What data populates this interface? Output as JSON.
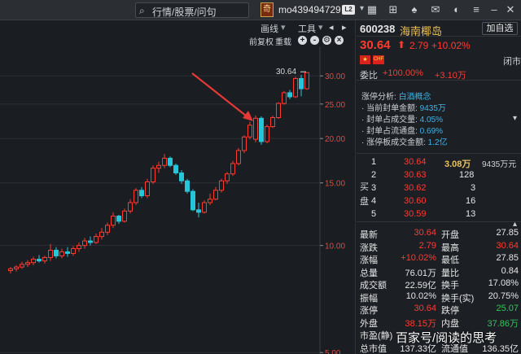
{
  "topbar": {
    "search_placeholder": "行情/股票/问句",
    "avatar_glyph": "奇",
    "username": "mo439494729",
    "level_badge": "L2",
    "icons": [
      "grid-icon",
      "gift-icon",
      "shirt-icon",
      "mail-icon",
      "palette-icon",
      "menu-icon",
      "minimize-icon",
      "maximize-icon",
      "close-icon"
    ]
  },
  "chart_toolbar": {
    "draw_line": "画线",
    "tools": "工具",
    "pre_adjust": "前复权",
    "overlay": "重载",
    "zoom_in": "+",
    "zoom_out": "-",
    "settings": "⚙",
    "close": "×"
  },
  "chart_data": {
    "type": "candlestick",
    "ylabel_ticks": [
      "30.00",
      "25.00",
      "20.00",
      "15.00",
      "10.00",
      "5.00"
    ],
    "y_scale": "log",
    "ylim": [
      5.0,
      32.0
    ],
    "high_label": "30.64",
    "annotation": "arrow pointing to large bullish candle",
    "candles": [
      {
        "o": 8.5,
        "h": 8.7,
        "l": 8.35,
        "c": 8.6
      },
      {
        "o": 8.6,
        "h": 8.8,
        "l": 8.45,
        "c": 8.7
      },
      {
        "o": 8.7,
        "h": 9.0,
        "l": 8.6,
        "c": 8.85
      },
      {
        "o": 8.85,
        "h": 9.1,
        "l": 8.7,
        "c": 8.95
      },
      {
        "o": 8.95,
        "h": 9.3,
        "l": 8.8,
        "c": 9.15
      },
      {
        "o": 9.15,
        "h": 9.4,
        "l": 8.95,
        "c": 9.05
      },
      {
        "o": 9.05,
        "h": 9.35,
        "l": 8.9,
        "c": 9.25
      },
      {
        "o": 9.25,
        "h": 10.1,
        "l": 9.05,
        "c": 9.7
      },
      {
        "o": 9.7,
        "h": 9.9,
        "l": 9.2,
        "c": 9.35
      },
      {
        "o": 9.35,
        "h": 9.8,
        "l": 9.2,
        "c": 9.6
      },
      {
        "o": 9.6,
        "h": 9.9,
        "l": 9.3,
        "c": 9.5
      },
      {
        "o": 9.5,
        "h": 9.95,
        "l": 9.35,
        "c": 9.8
      },
      {
        "o": 9.8,
        "h": 10.2,
        "l": 9.6,
        "c": 10.0
      },
      {
        "o": 10.0,
        "h": 10.5,
        "l": 9.8,
        "c": 10.3
      },
      {
        "o": 10.3,
        "h": 10.6,
        "l": 10.0,
        "c": 10.2
      },
      {
        "o": 10.2,
        "h": 10.8,
        "l": 10.1,
        "c": 10.6
      },
      {
        "o": 10.6,
        "h": 11.2,
        "l": 10.4,
        "c": 10.9
      },
      {
        "o": 10.9,
        "h": 11.6,
        "l": 10.7,
        "c": 11.4
      },
      {
        "o": 11.4,
        "h": 12.4,
        "l": 11.2,
        "c": 12.1
      },
      {
        "o": 12.1,
        "h": 12.2,
        "l": 11.5,
        "c": 11.7
      },
      {
        "o": 11.7,
        "h": 12.7,
        "l": 11.6,
        "c": 12.5
      },
      {
        "o": 12.5,
        "h": 13.5,
        "l": 12.3,
        "c": 13.2
      },
      {
        "o": 13.2,
        "h": 14.5,
        "l": 13.0,
        "c": 14.3
      },
      {
        "o": 14.3,
        "h": 14.6,
        "l": 13.6,
        "c": 13.8
      },
      {
        "o": 13.8,
        "h": 15.4,
        "l": 13.6,
        "c": 15.1
      },
      {
        "o": 15.1,
        "h": 16.8,
        "l": 14.9,
        "c": 16.5
      },
      {
        "o": 16.5,
        "h": 17.2,
        "l": 16.0,
        "c": 16.8
      },
      {
        "o": 16.8,
        "h": 18.1,
        "l": 16.5,
        "c": 17.6
      },
      {
        "o": 17.6,
        "h": 17.8,
        "l": 16.6,
        "c": 16.8
      },
      {
        "o": 16.8,
        "h": 17.0,
        "l": 15.8,
        "c": 16.0
      },
      {
        "o": 16.0,
        "h": 16.3,
        "l": 14.9,
        "c": 15.2
      },
      {
        "o": 15.2,
        "h": 15.4,
        "l": 14.0,
        "c": 14.2
      },
      {
        "o": 14.2,
        "h": 14.4,
        "l": 12.5,
        "c": 12.6
      },
      {
        "o": 12.6,
        "h": 13.2,
        "l": 12.0,
        "c": 12.4
      },
      {
        "o": 12.4,
        "h": 13.4,
        "l": 12.3,
        "c": 13.2
      },
      {
        "o": 13.2,
        "h": 14.0,
        "l": 13.0,
        "c": 13.5
      },
      {
        "o": 13.5,
        "h": 14.6,
        "l": 13.4,
        "c": 14.3
      },
      {
        "o": 14.3,
        "h": 15.4,
        "l": 14.1,
        "c": 15.2
      },
      {
        "o": 15.2,
        "h": 16.1,
        "l": 14.9,
        "c": 15.9
      },
      {
        "o": 15.9,
        "h": 17.3,
        "l": 15.7,
        "c": 17.0
      },
      {
        "o": 17.0,
        "h": 18.8,
        "l": 16.8,
        "c": 18.5
      },
      {
        "o": 18.5,
        "h": 20.4,
        "l": 18.2,
        "c": 20.2
      },
      {
        "o": 20.2,
        "h": 22.3,
        "l": 19.9,
        "c": 21.8
      },
      {
        "o": 19.9,
        "h": 23.2,
        "l": 19.5,
        "c": 22.8
      },
      {
        "o": 22.8,
        "h": 23.1,
        "l": 19.2,
        "c": 19.6
      },
      {
        "o": 19.6,
        "h": 21.9,
        "l": 19.4,
        "c": 21.6
      },
      {
        "o": 21.6,
        "h": 23.2,
        "l": 21.4,
        "c": 22.9
      },
      {
        "o": 22.9,
        "h": 25.3,
        "l": 22.7,
        "c": 25.1
      },
      {
        "o": 25.1,
        "h": 27.2,
        "l": 24.9,
        "c": 26.9
      },
      {
        "o": 26.9,
        "h": 27.4,
        "l": 25.8,
        "c": 26.2
      },
      {
        "o": 26.2,
        "h": 29.8,
        "l": 26.0,
        "c": 29.5
      },
      {
        "o": 29.5,
        "h": 30.2,
        "l": 26.3,
        "c": 27.6
      },
      {
        "o": 27.6,
        "h": 30.64,
        "l": 27.4,
        "c": 30.64
      }
    ]
  },
  "quote": {
    "code": "600238",
    "name": "海南椰岛",
    "add_self": "加自选",
    "price": "30.64",
    "change": "2.79",
    "change_pct": "+10.02%",
    "flag1": "CN",
    "flag2": "CHF",
    "status": "闭市",
    "ratio_label": "委比",
    "ratio_pct": "+100.00%",
    "ratio_diff": "+3.10万"
  },
  "analysis": {
    "title_label": "涨停分析:",
    "title_value": "白酒概念",
    "lines": [
      {
        "label": "· 当前封单金额:",
        "value": "9435万"
      },
      {
        "label": "· 封单占成交量:",
        "value": "4.05%"
      },
      {
        "label": "· 封单占流通盘:",
        "value": "0.69%"
      },
      {
        "label": "· 涨停板成交金额:",
        "value": "1.2亿"
      }
    ]
  },
  "orderbook": {
    "side_label": "买盘",
    "side_chars": [
      "买",
      "盘"
    ],
    "total": "9435万元",
    "rows": [
      {
        "level": "1",
        "price": "30.64",
        "volume": "3.08万"
      },
      {
        "level": "2",
        "price": "30.63",
        "volume": "128"
      },
      {
        "level": "3",
        "price": "30.62",
        "volume": "3"
      },
      {
        "level": "4",
        "price": "30.60",
        "volume": "16"
      },
      {
        "level": "5",
        "price": "30.59",
        "volume": "13"
      }
    ]
  },
  "stats": [
    {
      "l1": "最新",
      "v1": "30.64",
      "c1": "red",
      "l2": "开盘",
      "v2": "27.85",
      "c2": "white"
    },
    {
      "l1": "涨跌",
      "v1": "2.79",
      "c1": "red",
      "l2": "最高",
      "v2": "30.64",
      "c2": "red"
    },
    {
      "l1": "涨幅",
      "v1": "+10.02%",
      "c1": "red",
      "l2": "最低",
      "v2": "27.85",
      "c2": "white"
    },
    {
      "l1": "总量",
      "v1": "76.01万",
      "c1": "white",
      "l2": "量比",
      "v2": "0.84",
      "c2": "white"
    },
    {
      "l1": "成交额",
      "v1": "22.59亿",
      "c1": "white",
      "l2": "换手",
      "v2": "17.08%",
      "c2": "white"
    },
    {
      "l1": "振幅",
      "v1": "10.02%",
      "c1": "white",
      "l2": "换手(实)",
      "v2": "20.75%",
      "c2": "white"
    },
    {
      "l1": "涨停",
      "v1": "30.64",
      "c1": "red",
      "l2": "跌停",
      "v2": "25.07",
      "c2": "green"
    },
    {
      "l1": "外盘",
      "v1": "38.15万",
      "c1": "red",
      "l2": "内盘",
      "v2": "37.86万",
      "c2": "green"
    },
    {
      "l1": "市盈(静)",
      "v1": "",
      "c1": "white",
      "l2": "",
      "v2": "",
      "c2": "white"
    },
    {
      "l1": "总市值",
      "v1": "137.33亿",
      "c1": "white",
      "l2": "流通值",
      "v2": "136.35亿",
      "c2": "white"
    }
  ],
  "watermark": "百家号/阅读的思考",
  "colors": {
    "up": "#ff3b30",
    "down": "#26c6da",
    "accent": "#e8c25a"
  }
}
